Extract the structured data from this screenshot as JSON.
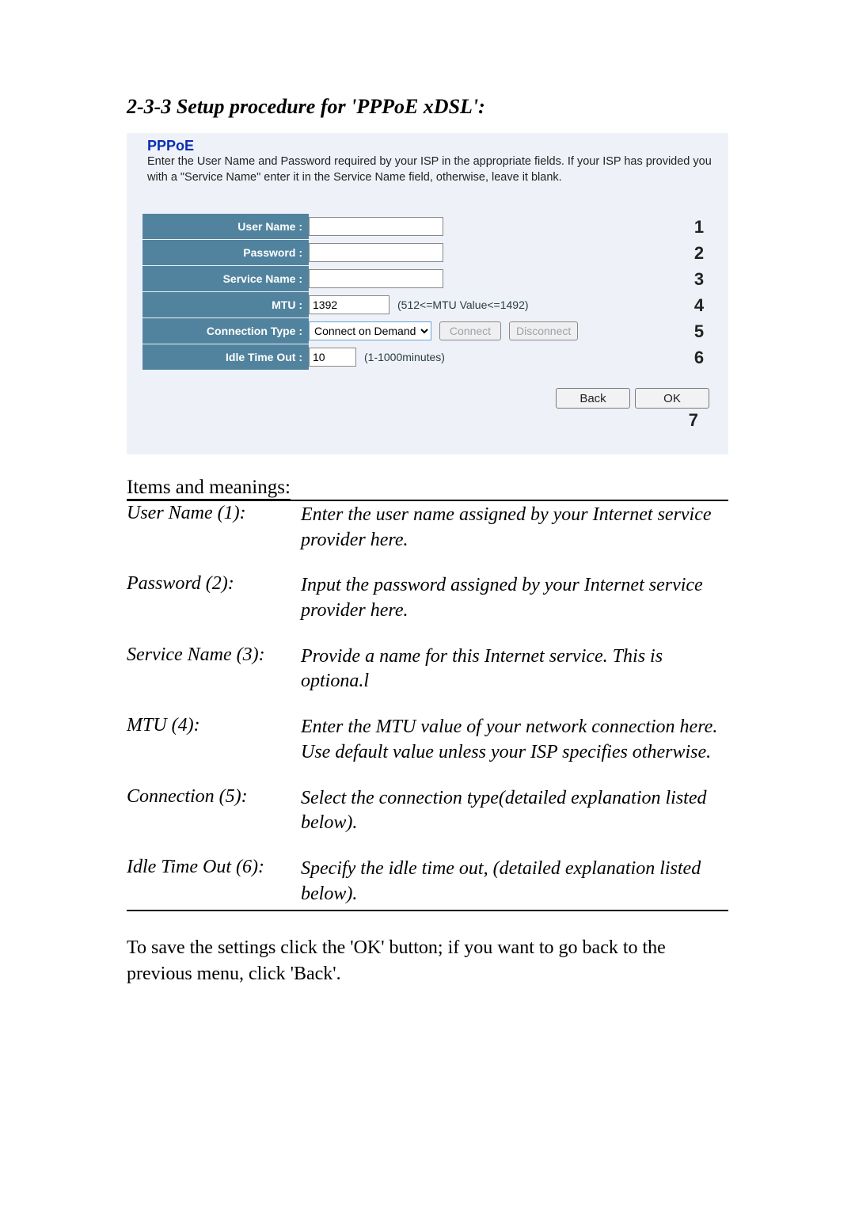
{
  "section_title": "2-3-3 Setup procedure for 'PPPoE xDSL':",
  "panel": {
    "title": "PPPoE",
    "desc": "Enter the User Name and Password required by your ISP in the appropriate fields. If your ISP has provided you with a \"Service Name\" enter it in the Service Name field, otherwise, leave it blank.",
    "rows": {
      "user_name_label": "User Name :",
      "password_label": "Password :",
      "service_name_label": "Service Name :",
      "mtu_label": "MTU :",
      "mtu_value": "1392",
      "mtu_hint": "(512<=MTU Value<=1492)",
      "conn_type_label": "Connection Type :",
      "conn_type_value": "Connect on Demand",
      "connect_btn": "Connect",
      "disconnect_btn": "Disconnect",
      "idle_label": "Idle Time Out :",
      "idle_value": "10",
      "idle_hint": "(1-1000minutes)"
    },
    "nums": {
      "n1": "1",
      "n2": "2",
      "n3": "3",
      "n4": "4",
      "n5": "5",
      "n6": "6",
      "n7": "7"
    },
    "back_btn": "Back",
    "ok_btn": "OK"
  },
  "items_heading": "Items and meanings:",
  "items": [
    {
      "term": "User Name (1):",
      "desc": "Enter the user name assigned by your Internet service provider here."
    },
    {
      "term": "Password (2):",
      "desc": "Input the password assigned by your Internet service provider here."
    },
    {
      "term": "Service Name (3):",
      "desc": "Provide a name for this Internet service. This is optiona.l"
    },
    {
      "term": "MTU (4):",
      "desc": "Enter the MTU value of your network connection here. Use default value unless your ISP specifies otherwise."
    },
    {
      "term": "Connection (5):",
      "desc": "Select the connection type(detailed explanation listed below)."
    },
    {
      "term": "Idle Time Out (6):",
      "desc": "Specify the idle time out, (detailed explanation listed below)."
    }
  ],
  "footer_note": "To save the settings click the 'OK' button; if you want to go back to the previous menu, click 'Back'."
}
